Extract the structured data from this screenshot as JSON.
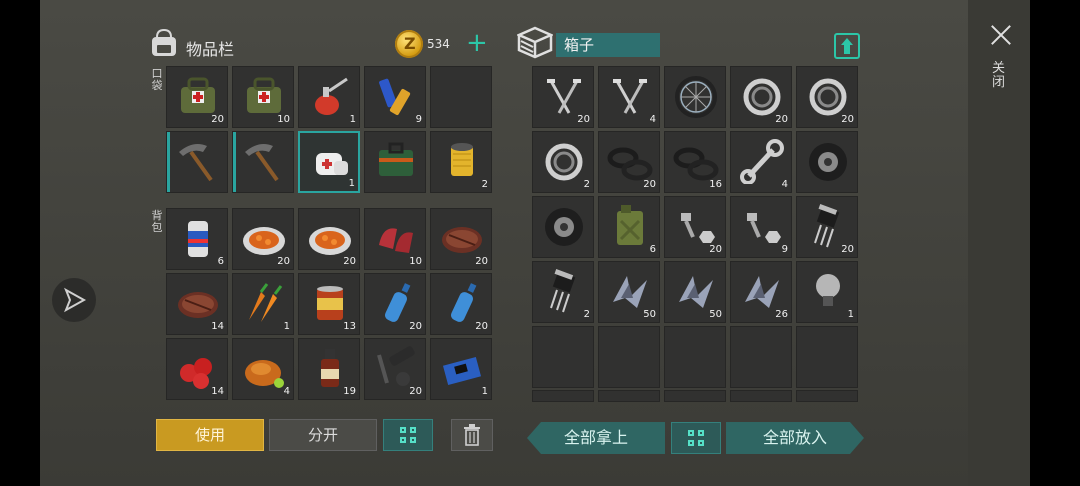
{
  "inventory": {
    "title": "物品栏",
    "coins": "534",
    "plus": "+"
  },
  "container": {
    "name": "箱子"
  },
  "sections": {
    "pocket": "口袋",
    "backpack": "背包"
  },
  "pocket_items": [
    {
      "name": "medkit-bag",
      "count": "20"
    },
    {
      "name": "medkit-bag",
      "count": "10"
    },
    {
      "name": "oil-can",
      "count": "1"
    },
    {
      "name": "batteries",
      "count": "9"
    },
    {
      "name": "empty",
      "count": ""
    },
    {
      "name": "pickaxe",
      "count": ""
    },
    {
      "name": "pickaxe",
      "count": ""
    },
    {
      "name": "bandage",
      "count": "1"
    },
    {
      "name": "first-aid-kit",
      "count": ""
    },
    {
      "name": "filter",
      "count": "2"
    }
  ],
  "backpack_items": [
    {
      "name": "beer-can",
      "count": "6"
    },
    {
      "name": "stew-plate",
      "count": "20"
    },
    {
      "name": "stew-plate",
      "count": "20"
    },
    {
      "name": "raw-meat",
      "count": "10"
    },
    {
      "name": "steak",
      "count": "20"
    },
    {
      "name": "steak",
      "count": "14"
    },
    {
      "name": "carrots",
      "count": "1"
    },
    {
      "name": "canned-food",
      "count": "13"
    },
    {
      "name": "water-bottle",
      "count": "20"
    },
    {
      "name": "water-bottle",
      "count": "20"
    },
    {
      "name": "tomatoes",
      "count": "14"
    },
    {
      "name": "roast-chicken",
      "count": "4"
    },
    {
      "name": "medicine-bottle",
      "count": "19"
    },
    {
      "name": "scope-parts",
      "count": "20"
    },
    {
      "name": "circuit-board",
      "count": "1"
    }
  ],
  "box_items": [
    {
      "name": "nails",
      "count": "20"
    },
    {
      "name": "nails",
      "count": "4"
    },
    {
      "name": "wheel",
      "count": ""
    },
    {
      "name": "bearing",
      "count": "20"
    },
    {
      "name": "bearing",
      "count": "20"
    },
    {
      "name": "bearing",
      "count": "2"
    },
    {
      "name": "gaskets",
      "count": "20"
    },
    {
      "name": "gaskets",
      "count": "16"
    },
    {
      "name": "wrench",
      "count": "4"
    },
    {
      "name": "tire",
      "count": ""
    },
    {
      "name": "tire",
      "count": ""
    },
    {
      "name": "jerrycan",
      "count": "6"
    },
    {
      "name": "bolts",
      "count": "20"
    },
    {
      "name": "bolts",
      "count": "9"
    },
    {
      "name": "transistor",
      "count": "20"
    },
    {
      "name": "transistor",
      "count": "2"
    },
    {
      "name": "metal-scrap",
      "count": "50"
    },
    {
      "name": "metal-scrap",
      "count": "50"
    },
    {
      "name": "metal-scrap",
      "count": "26"
    },
    {
      "name": "light-bulb",
      "count": "1"
    }
  ],
  "buttons": {
    "use": "使用",
    "split": "分开",
    "take_all": "全部拿上",
    "put_all": "全部放入",
    "close": "关闭"
  },
  "colors": {
    "accent": "#2aa5a0",
    "use_button": "#c99a21",
    "coin": "#e3b52a"
  }
}
